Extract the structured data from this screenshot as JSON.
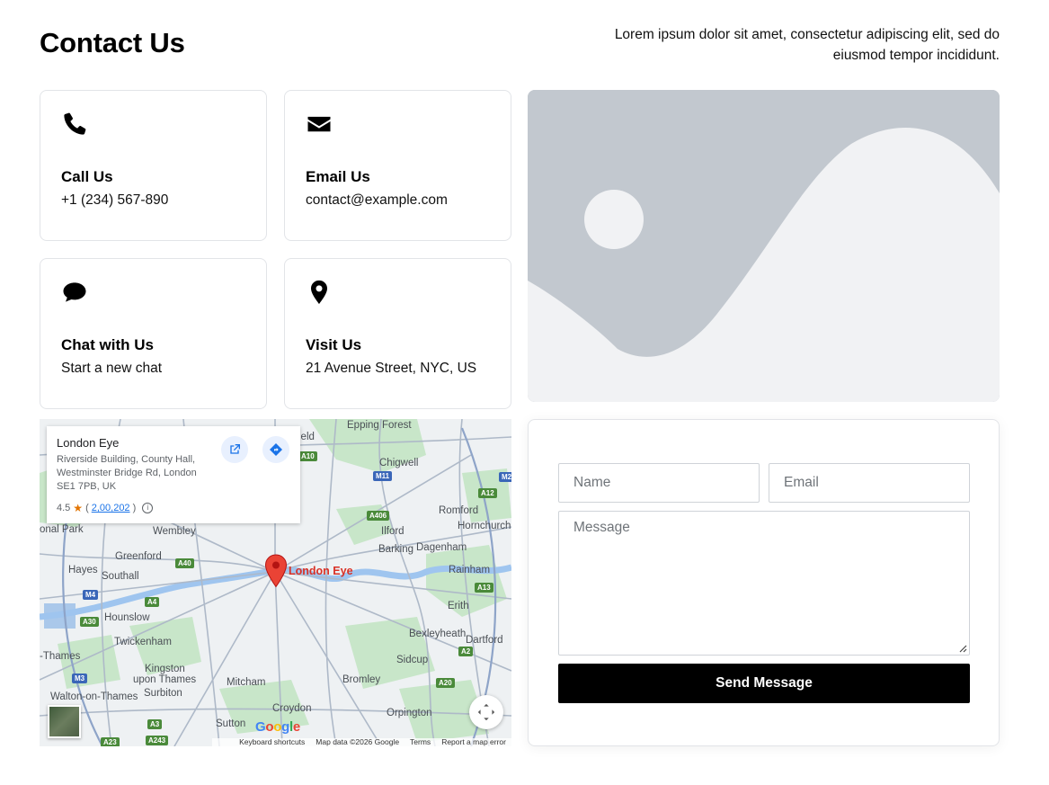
{
  "header": {
    "title": "Contact Us",
    "intro": "Lorem ipsum dolor sit amet, consectetur adipiscing elit, sed do eiusmod tempor incididunt."
  },
  "cards": [
    {
      "icon": "phone-icon",
      "title": "Call Us",
      "value": "+1 (234) 567-890"
    },
    {
      "icon": "envelope-icon",
      "title": "Email Us",
      "value": "contact@example.com"
    },
    {
      "icon": "chat-bubble-icon",
      "title": "Chat with Us",
      "value": "Start a new chat"
    },
    {
      "icon": "map-pin-icon",
      "title": "Visit Us",
      "value": "21 Avenue Street, NYC, US"
    }
  ],
  "map": {
    "place_name": "London Eye",
    "address": "Riverside Building, County Hall, Westminster Bridge Rd, London SE1 7PB, UK",
    "rating": "4.5",
    "review_count": "2,00,202",
    "pin_label": "London Eye",
    "google_logo": "Google",
    "footer": {
      "shortcuts": "Keyboard shortcuts",
      "data": "Map data ©2026 Google",
      "terms": "Terms",
      "report": "Report a map error"
    },
    "labels": {
      "epping": "Epping Forest",
      "chigwell": "Chigwell",
      "romford": "Romford",
      "hornchurch": "Hornchurch",
      "ilford": "Ilford",
      "barking": "Barking",
      "dagenham": "Dagenham",
      "rainham": "Rainham",
      "wembley": "Wembley",
      "greenford": "Greenford",
      "hayes": "Hayes",
      "southall": "Southall",
      "hounslow": "Hounslow",
      "twickenham": "Twickenham",
      "thames": "-Thames",
      "kingston": "Kingston",
      "upon_thames": "upon Thames",
      "surbiton": "Surbiton",
      "mitcham": "Mitcham",
      "walton": "Walton-on-Thames",
      "sutton": "Sutton",
      "croydon": "Croydon",
      "bromley": "Bromley",
      "orpington": "Orpington",
      "sidcup": "Sidcup",
      "bexleyheath": "Bexleyheath",
      "dartford": "Dartford",
      "erith": "Erith",
      "nal_park": "onal Park",
      "field": "ield"
    },
    "roads": {
      "a10": "A10",
      "m11": "M11",
      "a12": "A12",
      "m25": "M25",
      "a406": "A406",
      "a40": "A40",
      "m4": "M4",
      "a4": "A4",
      "a30": "A30",
      "a13": "A13",
      "a2": "A2",
      "a20": "A20",
      "m3": "M3",
      "a3": "A3",
      "a243": "A243",
      "a23": "A23"
    }
  },
  "form": {
    "name_placeholder": "Name",
    "email_placeholder": "Email",
    "message_placeholder": "Message",
    "submit_label": "Send Message"
  },
  "colors": {
    "placeholder_bg": "#c2c8cf",
    "placeholder_fg": "#f1f2f4",
    "button_bg": "#000000",
    "pin_red": "#d93025"
  }
}
